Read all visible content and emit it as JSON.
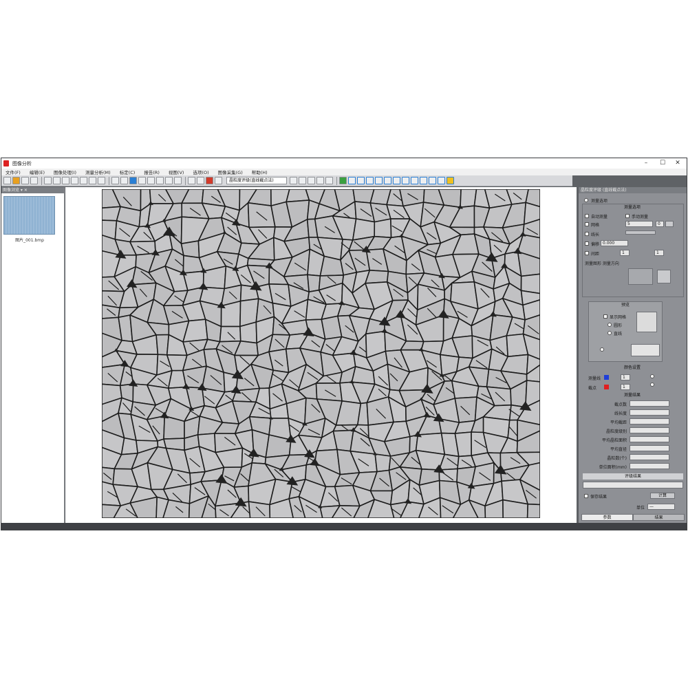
{
  "window": {
    "title": "图像分析",
    "controls": {
      "minimize": "–",
      "maximize": "☐",
      "close": "✕"
    }
  },
  "menu": [
    "文件(F)",
    "编辑(E)",
    "图像处理(I)",
    "测量分析(M)",
    "标定(C)",
    "报告(R)",
    "视图(V)",
    "选项(O)",
    "图像采集(G)",
    "帮助(H)"
  ],
  "toolbar": {
    "combo_value": "晶粒度评级(直线截点法)",
    "accent_colors": [
      "#e8a020",
      "#2a7fd4",
      "#d23a2a",
      "#3aa040",
      "#f0c020"
    ]
  },
  "left_panel": {
    "header": "图像浏览 ▾ ✕",
    "thumb_label": "图片_001.bmp"
  },
  "right_panel": {
    "header": "晶粒度评级 (直线截点法)",
    "options_title": "测量选项",
    "check_auto": "自动测量",
    "check_manual": "手动测量",
    "field_count": "5",
    "field_step": "0",
    "length_label": "线长",
    "grid_label": "网格",
    "offset_label": "偏移",
    "offset_value": "0.000",
    "spacing_label": "间距",
    "spacing_a": "1",
    "spacing_b": "1",
    "pattern_label": "测量图形 测量方向",
    "preview_title": "预览",
    "preview_check": "显示网格",
    "preview_opt1": "圆形",
    "preview_opt2": "直线",
    "color_label": "颜色设置",
    "color_line": "测量线",
    "color_point": "截点",
    "color_line_hex": "#1f3fd8",
    "color_point_hex": "#e02020",
    "thick_a": "1",
    "thick_b": "1",
    "result_title": "测量结果",
    "results": [
      {
        "label": "截点数",
        "value": ""
      },
      {
        "label": "线长度",
        "value": ""
      },
      {
        "label": "平均截距",
        "value": ""
      },
      {
        "label": "晶粒度级别",
        "value": ""
      },
      {
        "label": "平均晶粒面积",
        "value": ""
      },
      {
        "label": "平均直径",
        "value": ""
      },
      {
        "label": "晶粒数(个)",
        "value": ""
      },
      {
        "label": "单位面积(mm)",
        "value": ""
      }
    ],
    "grade_title": "评级结果",
    "grade_value": "",
    "save_check": "保存结果",
    "save_button": "计算",
    "unit_label": "单位",
    "unit_value": "—",
    "tabs": [
      "参数",
      "结果"
    ]
  }
}
